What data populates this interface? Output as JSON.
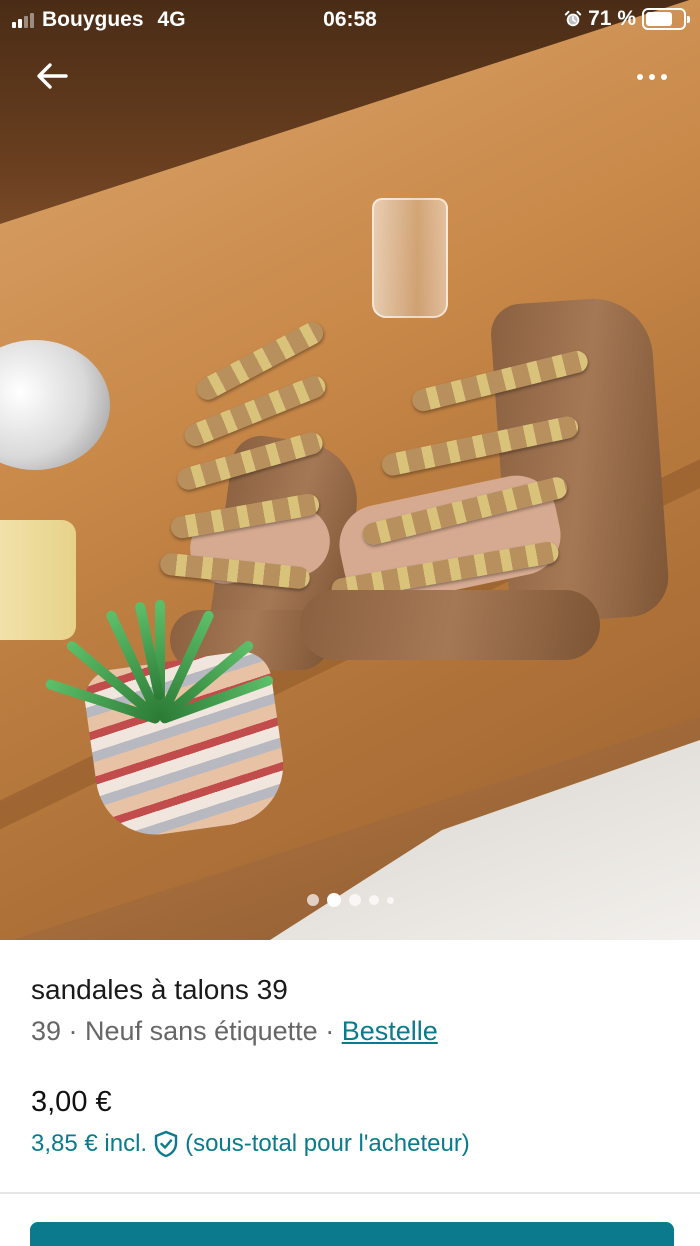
{
  "status_bar": {
    "carrier": "Bouygues",
    "network": "4G",
    "time": "06:58",
    "battery_text": "71 %",
    "battery_level": 0.71,
    "signal_bars_active": 2,
    "icons": [
      "signal-icon",
      "alarm-icon",
      "battery-icon"
    ]
  },
  "nav": {
    "back_icon": "arrow-left-icon",
    "more_icon": "more-dots-icon"
  },
  "gallery": {
    "photo_count": 5,
    "active_index": 1
  },
  "item": {
    "title": "sandales à talons 39",
    "size": "39",
    "separator": " · ",
    "condition": "Neuf sans étiquette",
    "brand": "Bestelle",
    "price": "3,00 €",
    "buyer_price": "3,85 € incl.",
    "buyer_note": "(sous-total pour l'acheteur)",
    "protection_icon": "shield-check-icon"
  },
  "colors": {
    "accent": "#0b7a8c"
  }
}
